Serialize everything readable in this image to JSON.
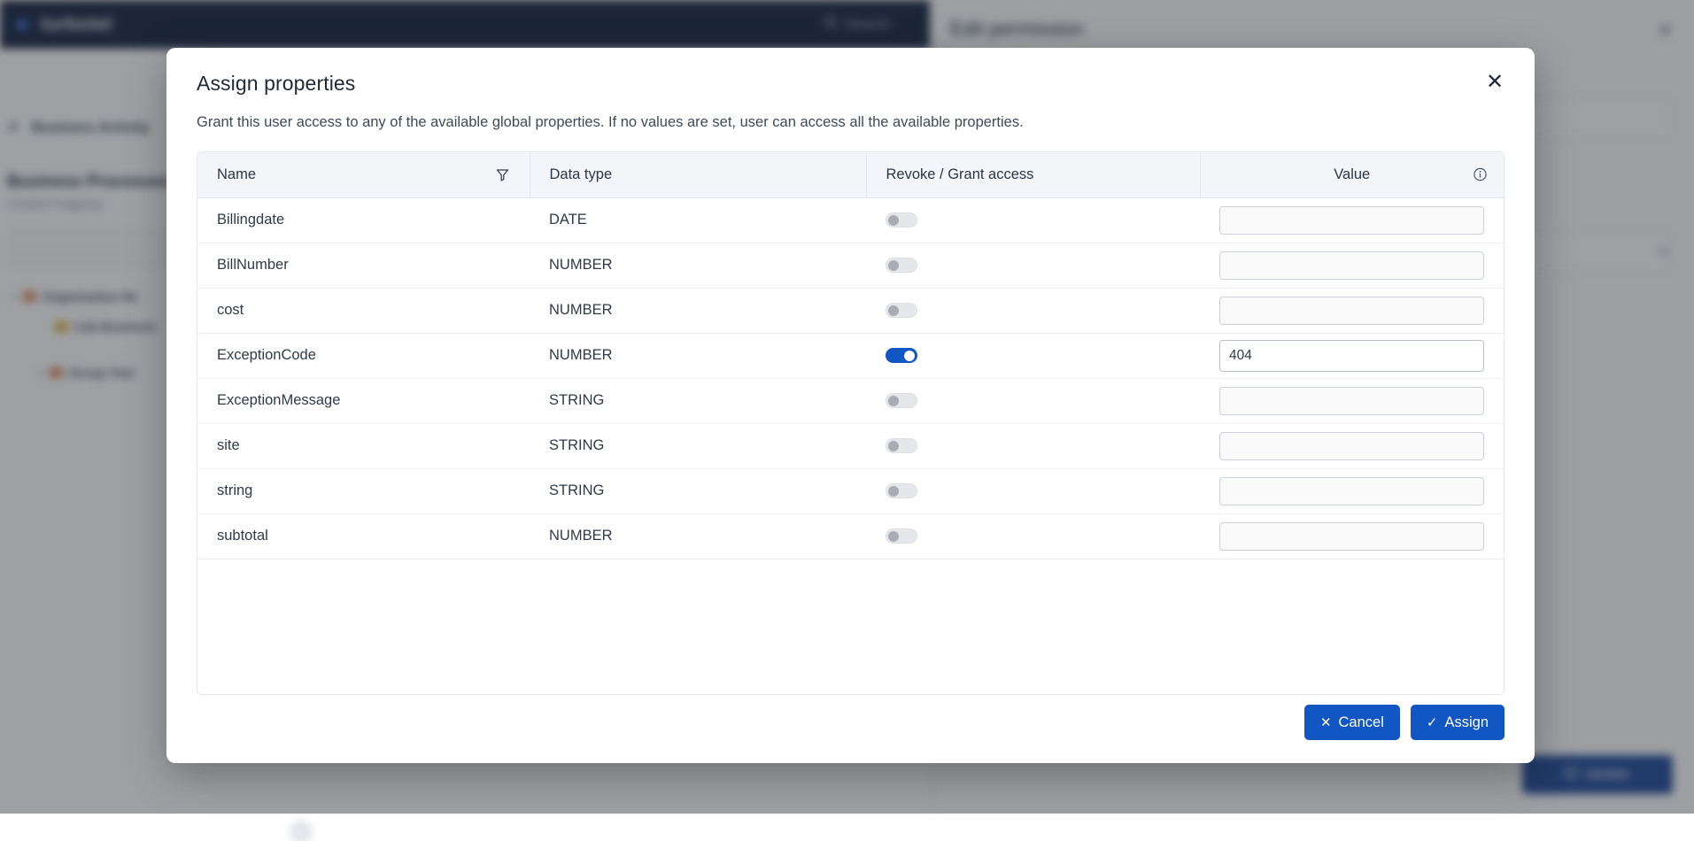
{
  "background": {
    "brand": "turbotel",
    "search_label": "Search",
    "section_label": "Business Activity",
    "page_title": "Business Processes",
    "page_subtitle": "Content mapping",
    "tree_items": [
      {
        "label": "Organization Ne",
        "caret": "▸",
        "color": "#d8885b"
      },
      {
        "label": "Cab Business",
        "caret": "",
        "color": "#e0b23c"
      },
      {
        "label": "Group Test",
        "caret": "▸",
        "color": "#d8885b"
      }
    ],
    "panel_title": "Edit permission",
    "panel_close": "✕",
    "update_label": "Update"
  },
  "modal": {
    "title": "Assign properties",
    "close_label": "✕",
    "description": "Grant this user access to any of the available global properties. If no values are set, user can access all the available properties.",
    "columns": {
      "name": "Name",
      "data_type": "Data type",
      "access": "Revoke / Grant access",
      "value": "Value"
    },
    "icons": {
      "filter": "filter-icon",
      "info": "info-icon"
    },
    "rows": [
      {
        "name": "Billingdate",
        "data_type": "DATE",
        "granted": false,
        "value": ""
      },
      {
        "name": "BillNumber",
        "data_type": "NUMBER",
        "granted": false,
        "value": ""
      },
      {
        "name": "cost",
        "data_type": "NUMBER",
        "granted": false,
        "value": ""
      },
      {
        "name": "ExceptionCode",
        "data_type": "NUMBER",
        "granted": true,
        "value": "404"
      },
      {
        "name": "ExceptionMessage",
        "data_type": "STRING",
        "granted": false,
        "value": ""
      },
      {
        "name": "site",
        "data_type": "STRING",
        "granted": false,
        "value": ""
      },
      {
        "name": "string",
        "data_type": "STRING",
        "granted": false,
        "value": ""
      },
      {
        "name": "subtotal",
        "data_type": "NUMBER",
        "granted": false,
        "value": ""
      }
    ],
    "footer": {
      "cancel_label": "Cancel",
      "cancel_glyph": "✕",
      "assign_label": "Assign",
      "assign_glyph": "✓"
    }
  },
  "colors": {
    "accent": "#1256c4",
    "topbar": "#14213f",
    "header_row": "#f4f5f9",
    "toggle_off": "#e6e7eb"
  }
}
